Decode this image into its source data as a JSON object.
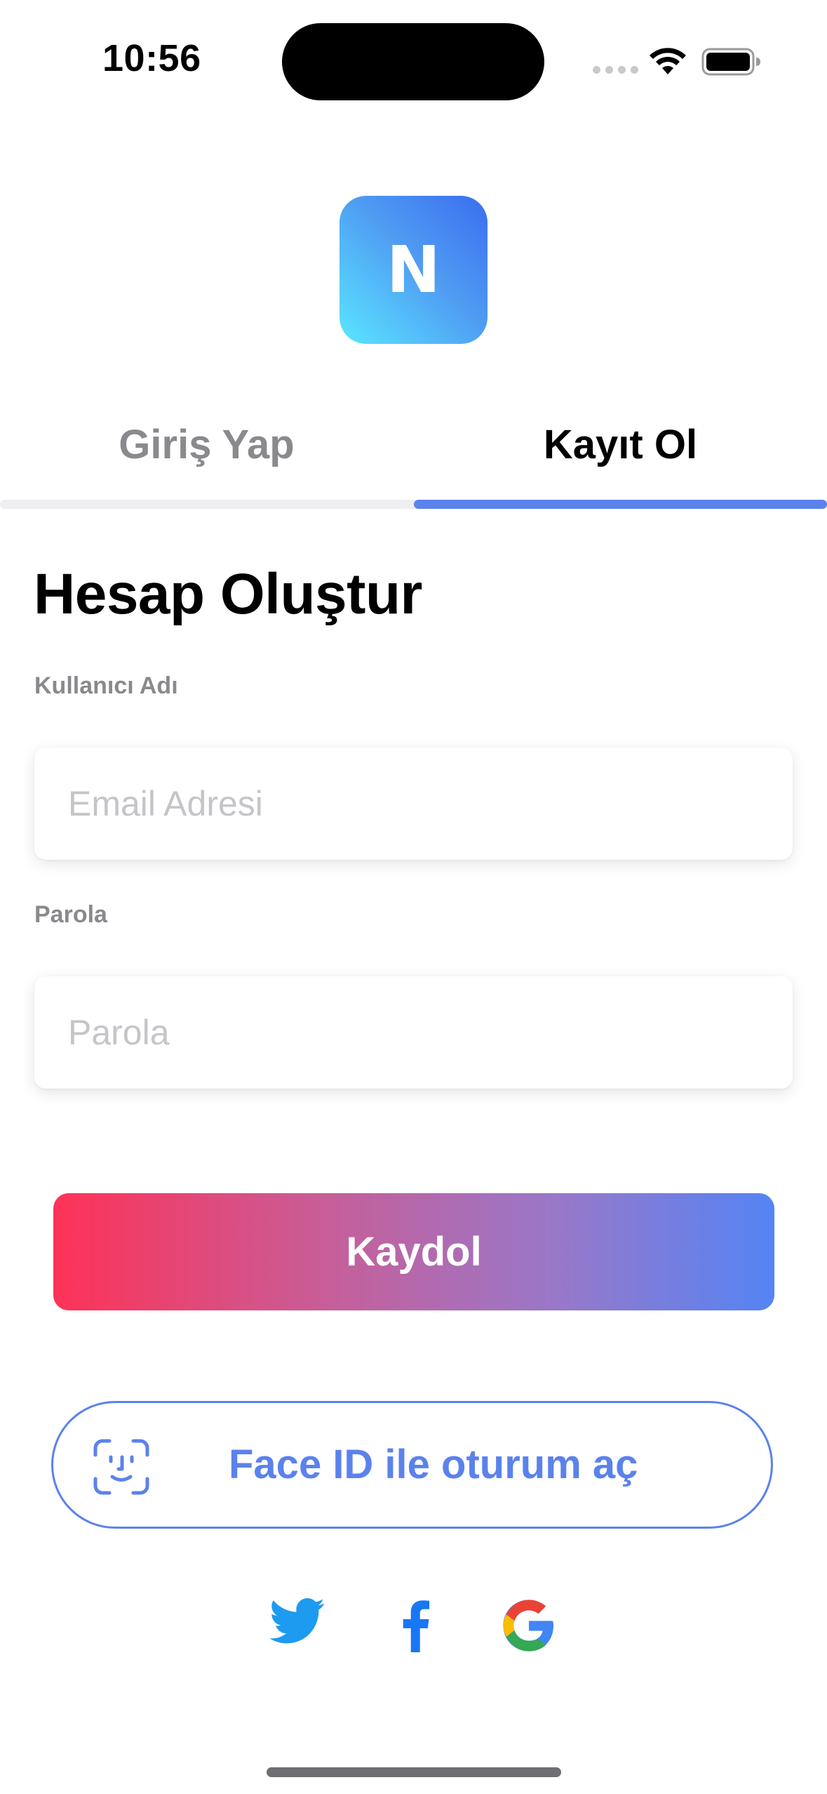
{
  "status_bar": {
    "time": "10:56"
  },
  "logo": {
    "letter": "N"
  },
  "tabs": [
    {
      "label": "Giriş Yap",
      "selected": false
    },
    {
      "label": "Kayıt Ol",
      "selected": true
    }
  ],
  "form": {
    "title": "Hesap Oluştur",
    "username": {
      "label": "Kullanıcı Adı",
      "value": "",
      "placeholder": "Email Adresi"
    },
    "password": {
      "label": "Parola",
      "value": "",
      "placeholder": "Parola"
    }
  },
  "buttons": {
    "register_label": "Kaydol",
    "faceid_label": "Face ID ile oturum aç"
  },
  "social": {
    "icons": [
      "twitter-icon",
      "facebook-icon",
      "google-icon"
    ]
  },
  "colors": {
    "accent": "#5b82ec",
    "gradient_start": "#fe3257",
    "gradient_end": "#5484f4",
    "twitter": "#1d9bf0",
    "facebook": "#1877f2",
    "label_gray": "#8a8a8e"
  }
}
